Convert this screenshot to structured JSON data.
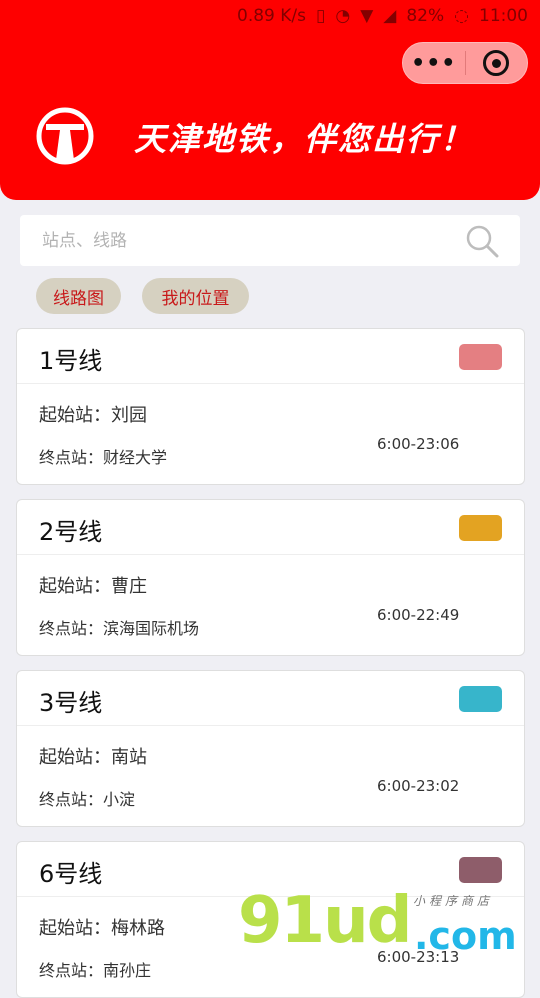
{
  "status_bar": {
    "speed": "0.89 K/s",
    "battery": "82%",
    "time": "11:00",
    "icons": [
      "vibrate-icon",
      "alarm-icon",
      "wifi-icon",
      "signal-icon",
      "battery-icon"
    ]
  },
  "header": {
    "slogan": "天津地铁，伴您出行！",
    "background": "#fe0000",
    "logo": "tianjin-metro-logo"
  },
  "capsule": {
    "more": "•••",
    "icons": [
      "more-icon",
      "close-target-icon"
    ]
  },
  "search": {
    "placeholder": "站点、线路",
    "icon": "search-icon"
  },
  "quick_buttons": [
    {
      "label": "线路图"
    },
    {
      "label": "我的位置"
    }
  ],
  "lines": [
    {
      "name": "1号线",
      "start_label": "起始站：",
      "start": "刘园",
      "end_label": "终点站：",
      "end": "财经大学",
      "hours": "6:00-23:06",
      "color": "#e47f82"
    },
    {
      "name": "2号线",
      "start_label": "起始站：",
      "start": "曹庄",
      "end_label": "终点站：",
      "end": "滨海国际机场",
      "hours": "6:00-22:49",
      "color": "#e3a322"
    },
    {
      "name": "3号线",
      "start_label": "起始站：",
      "start": "南站",
      "end_label": "终点站：",
      "end": "小淀",
      "hours": "6:00-23:02",
      "color": "#37b5cb"
    },
    {
      "name": "6号线",
      "start_label": "起始站：",
      "start": "梅林路",
      "end_label": "终点站：",
      "end": "南孙庄",
      "hours": "6:00-23:13",
      "color": "#8e5d6a"
    }
  ],
  "watermark": {
    "num": "91ud",
    "com": ".com",
    "small": "小程序商店"
  }
}
